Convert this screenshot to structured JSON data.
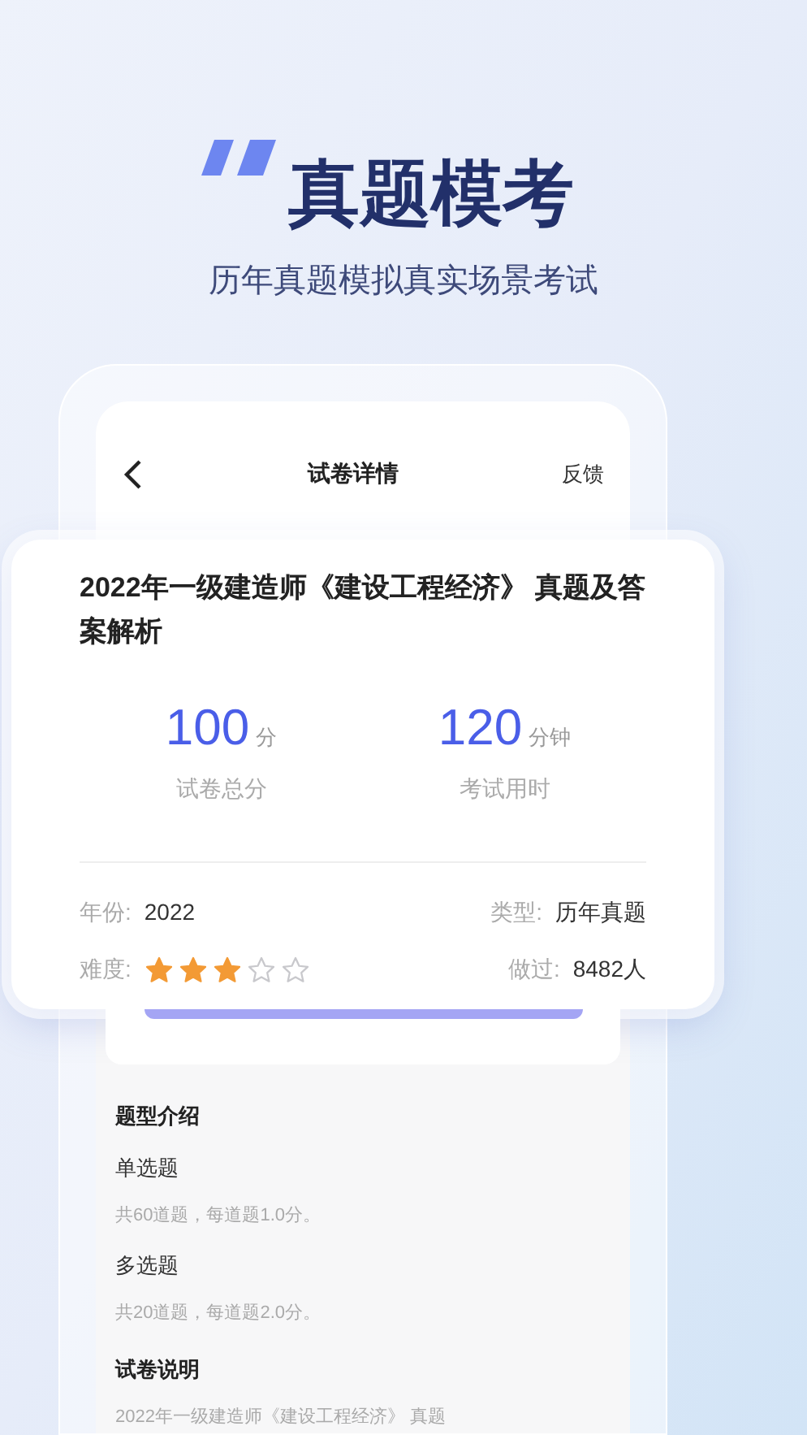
{
  "headline": {
    "title": "真题模考",
    "subtitle": "历年真题模拟真实场景考试"
  },
  "nav": {
    "title": "试卷详情",
    "action": "反馈"
  },
  "paper": {
    "title": "2022年一级建造师《建设工程经济》 真题及答案解析",
    "stats": [
      {
        "value": "100",
        "unit": "分",
        "label": "试卷总分"
      },
      {
        "value": "120",
        "unit": "分钟",
        "label": "考试用时"
      }
    ],
    "year_label": "年份:",
    "year": "2022",
    "type_label": "类型:",
    "type": "历年真题",
    "difficulty_label": "难度:",
    "stars": 3,
    "done_label": "做过:",
    "done": "8482人"
  },
  "sections": [
    {
      "kind": "heading",
      "text": "题型介绍"
    },
    {
      "kind": "item",
      "text": "单选题"
    },
    {
      "kind": "desc",
      "text": "共60道题，每道题1.0分。"
    },
    {
      "kind": "item",
      "text": "多选题"
    },
    {
      "kind": "desc",
      "text": "共20道题，每道题2.0分。"
    },
    {
      "kind": "heading",
      "text": "试卷说明"
    },
    {
      "kind": "desc",
      "text": "2022年一级建造师《建设工程经济》 真题"
    }
  ]
}
